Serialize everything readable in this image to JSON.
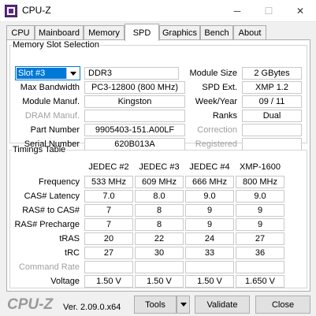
{
  "window": {
    "title": "CPU-Z",
    "minimize": "─",
    "maximize": "☐",
    "close": "✕"
  },
  "tabs": [
    {
      "label": "CPU",
      "active": false
    },
    {
      "label": "Mainboard",
      "active": false
    },
    {
      "label": "Memory",
      "active": false
    },
    {
      "label": "SPD",
      "active": true
    },
    {
      "label": "Graphics",
      "active": false
    },
    {
      "label": "Bench",
      "active": false
    },
    {
      "label": "About",
      "active": false
    }
  ],
  "slot_section": {
    "legend": "Memory Slot Selection",
    "slot_select": "Slot #3",
    "memory_type": "DDR3",
    "max_bandwidth_label": "Max Bandwidth",
    "max_bandwidth": "PC3-12800 (800 MHz)",
    "module_manuf_label": "Module Manuf.",
    "module_manuf": "Kingston",
    "dram_manuf_label": "DRAM Manuf.",
    "dram_manuf": "",
    "part_number_label": "Part Number",
    "part_number": "9905403-151.A00LF",
    "serial_number_label": "Serial Number",
    "serial_number": "620B013A",
    "module_size_label": "Module Size",
    "module_size": "2 GBytes",
    "spd_ext_label": "SPD Ext.",
    "spd_ext": "XMP 1.2",
    "week_year_label": "Week/Year",
    "week_year": "09 / 11",
    "ranks_label": "Ranks",
    "ranks": "Dual",
    "correction_label": "Correction",
    "correction": "",
    "registered_label": "Registered",
    "registered": ""
  },
  "timings": {
    "legend": "Timings Table",
    "columns": [
      "JEDEC #2",
      "JEDEC #3",
      "JEDEC #4",
      "XMP-1600"
    ],
    "rows": [
      {
        "label": "Frequency",
        "values": [
          "533 MHz",
          "609 MHz",
          "666 MHz",
          "800 MHz"
        ],
        "disabled": false
      },
      {
        "label": "CAS# Latency",
        "values": [
          "7.0",
          "8.0",
          "9.0",
          "9.0"
        ],
        "disabled": false
      },
      {
        "label": "RAS# to CAS#",
        "values": [
          "7",
          "8",
          "9",
          "9"
        ],
        "disabled": false
      },
      {
        "label": "RAS# Precharge",
        "values": [
          "7",
          "8",
          "9",
          "9"
        ],
        "disabled": false
      },
      {
        "label": "tRAS",
        "values": [
          "20",
          "22",
          "24",
          "27"
        ],
        "disabled": false
      },
      {
        "label": "tRC",
        "values": [
          "27",
          "30",
          "33",
          "36"
        ],
        "disabled": false
      },
      {
        "label": "Command Rate",
        "values": [
          "",
          "",
          "",
          ""
        ],
        "disabled": true
      },
      {
        "label": "Voltage",
        "values": [
          "1.50 V",
          "1.50 V",
          "1.50 V",
          "1.650 V"
        ],
        "disabled": false
      }
    ]
  },
  "footer": {
    "brand": "CPU-Z",
    "version": "Ver. 2.09.0.x64",
    "tools_label": "Tools",
    "validate_label": "Validate",
    "close_label": "Close"
  }
}
